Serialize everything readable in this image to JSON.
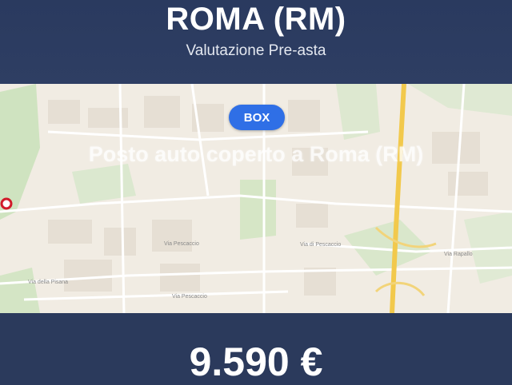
{
  "header": {
    "city": "ROMA (RM)",
    "subtitle": "Valutazione Pre-asta"
  },
  "map": {
    "badge": "BOX",
    "listing_title": "Posto auto coperto a Roma (RM)",
    "pin_icon": "location-pin-icon",
    "road_labels": [
      "Via Pescaccio",
      "Via di Pescaccio",
      "Via Rapallo",
      "Via della Pisana",
      "Via Pescaccio"
    ]
  },
  "footer": {
    "price": "9.590 €"
  },
  "colors": {
    "header_bg": "#2a3a5f",
    "badge_bg": "#2f6fe6",
    "pin": "#d11a2a",
    "highway": "#f2c94c"
  }
}
